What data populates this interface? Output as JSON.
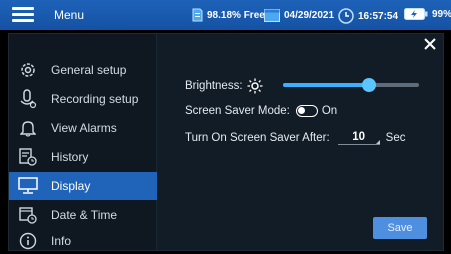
{
  "topbar": {
    "menu_label": "Menu",
    "storage": "98.18% Free",
    "date": "04/29/2021",
    "time": "16:57:54",
    "battery": "99%"
  },
  "sidebar": {
    "items": [
      {
        "label": "General setup",
        "icon": "gear-icon"
      },
      {
        "label": "Recording setup",
        "icon": "microphone-icon"
      },
      {
        "label": "View Alarms",
        "icon": "bell-icon"
      },
      {
        "label": "History",
        "icon": "history-icon"
      },
      {
        "label": "Display",
        "icon": "monitor-icon",
        "active": true
      },
      {
        "label": "Date & Time",
        "icon": "calendar-clock-icon"
      },
      {
        "label": "Info",
        "icon": "info-icon"
      }
    ]
  },
  "display": {
    "brightness_label": "Brightness:",
    "brightness_level": 0.63,
    "screensaver_label": "Screen Saver Mode:",
    "screensaver_state": "On",
    "turn_on_label": "Turn On Screen Saver After:",
    "turn_on_value": "10",
    "turn_on_unit": "Sec",
    "save_label": "Save"
  },
  "colors": {
    "topbar": "#1a5bb0",
    "accent": "#1f64b8",
    "slider": "#3ab0ff",
    "panel": "#121c26"
  }
}
